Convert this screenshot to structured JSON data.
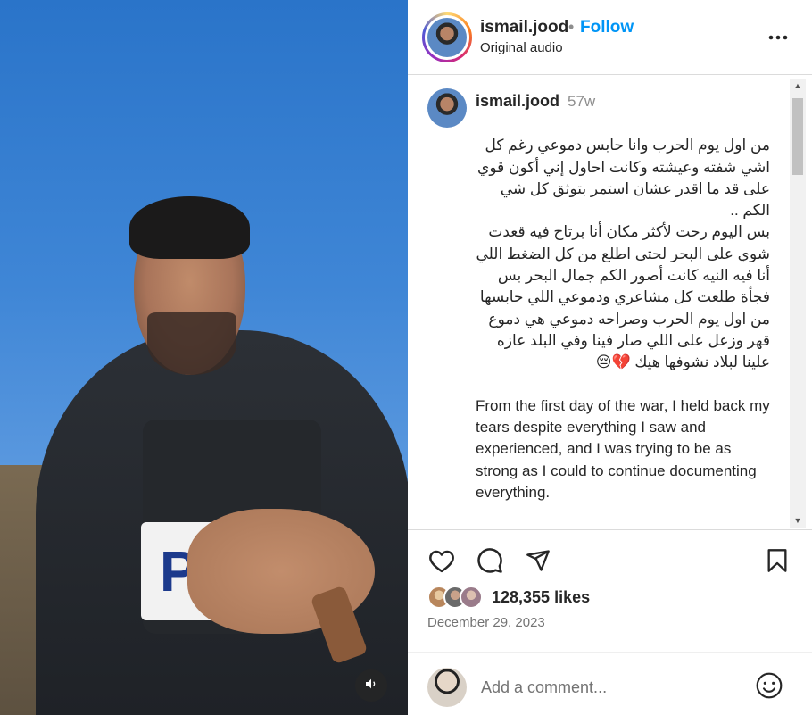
{
  "post": {
    "username": "ismail.jood",
    "follow_dot": "•",
    "follow_label": "Follow",
    "audio_label": "Original audio"
  },
  "media": {
    "vest_text": "PRES"
  },
  "caption": {
    "username": "ismail.jood",
    "time_ago": "57w",
    "arabic_text": "من اول يوم الحرب وانا حابس دموعي رغم كل اشي شفته وعيشته وكانت احاول إني أكون قوي على قد ما اقدر عشان استمر بتوثق كل شي الكم ..\nبس اليوم رحت لأكثر مكان أنا برتاح فيه قعدت شوي على البحر لحتى اطلع من كل الضغط اللي أنا فيه النيه كانت أصور الكم جمال البحر بس فجأة طلعت كل مشاعري ودموعي اللي حابسها من اول يوم الحرب وصراحه دموعي هي دموع قهر وزعل على اللي صار فينا وفي البلد عازه علينا لبلاد نشوفها هيك 💔😔",
    "english_text": "From the first day of the war, I held back my tears despite everything I saw and experienced, and I was trying to be as strong as I could to continue documenting everything.\n\nBut today I went to the most comfortable place for me..."
  },
  "stats": {
    "likes": "128,355 likes",
    "date": "December 29, 2023"
  },
  "comment": {
    "placeholder": "Add a comment..."
  },
  "icons": [
    "more-icon",
    "heart-icon",
    "comment-icon",
    "share-icon",
    "bookmark-icon",
    "emoji-icon",
    "speaker-icon"
  ],
  "colors": {
    "follow": "#0095f6",
    "text": "#262626",
    "muted": "#737373"
  }
}
